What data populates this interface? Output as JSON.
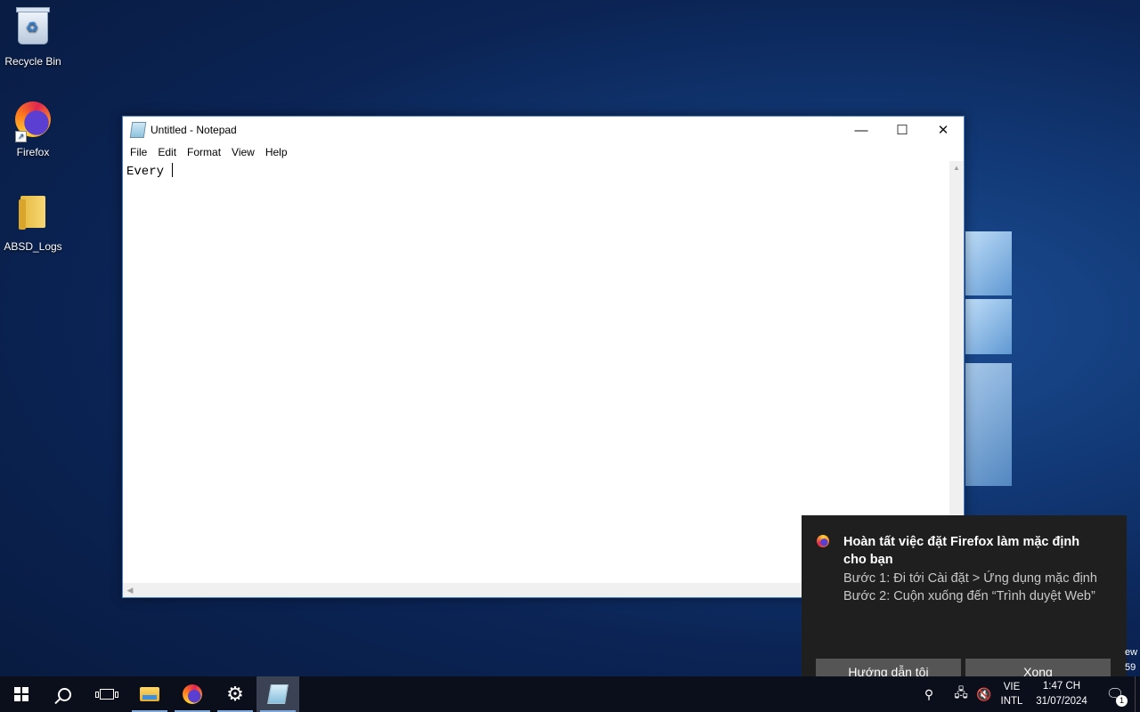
{
  "desktop": {
    "icons": [
      {
        "label": "Recycle Bin"
      },
      {
        "label": "Firefox"
      },
      {
        "label": "ABSD_Logs"
      }
    ]
  },
  "notepad": {
    "title": "Untitled - Notepad",
    "controls": {
      "minimize": "—",
      "maximize": "☐",
      "close": "✕"
    },
    "menu": [
      "File",
      "Edit",
      "Format",
      "View",
      "Help"
    ],
    "content": "Every "
  },
  "toast": {
    "title": "Hoàn tất việc đặt Firefox làm mặc định cho bạn",
    "step1": "Bước 1: Đi tới Cài đặt > Ứng dụng mặc định",
    "step2": "Bước 2: Cuộn xuống đến “Trình duyệt Web”",
    "button_guide": "Hướng dẫn tôi",
    "button_done": "Xong",
    "edge_text_1": "ew",
    "edge_text_2": "59"
  },
  "taskbar": {
    "apps": [
      {
        "icon": "start-icon"
      },
      {
        "icon": "search-icon"
      },
      {
        "icon": "task-view-icon"
      },
      {
        "icon": "file-explorer-icon"
      },
      {
        "icon": "firefox-icon"
      },
      {
        "icon": "settings-icon"
      },
      {
        "icon": "notepad-icon"
      }
    ],
    "language": {
      "line1": "VIE",
      "line2": "INTL"
    },
    "time": "1:47 CH",
    "date": "31/07/2024",
    "notification_count": "1"
  }
}
